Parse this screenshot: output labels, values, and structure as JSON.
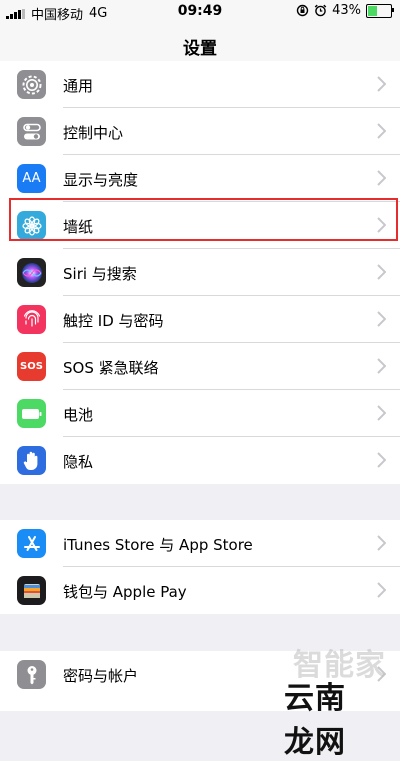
{
  "status_bar": {
    "carrier": "中国移动",
    "network": "4G",
    "time": "09:49",
    "battery": "43%",
    "battery_level": 0.43
  },
  "nav": {
    "title": "设置"
  },
  "groups": [
    {
      "items": [
        {
          "label": "通用",
          "icon": "gear-icon",
          "color": "#8e8e93"
        },
        {
          "label": "控制中心",
          "icon": "toggle-icon",
          "color": "#8e8e93"
        },
        {
          "label": "显示与亮度",
          "icon": "aa-icon",
          "color": "#1a7cf5",
          "icon_text": "AA"
        },
        {
          "label": "墙纸",
          "icon": "flower-icon",
          "color": "#34aadc"
        },
        {
          "label": "Siri 与搜索",
          "icon": "siri-icon",
          "color": "#222222"
        },
        {
          "label": "触控 ID 与密码",
          "icon": "fingerprint-icon",
          "color": "#f2345f"
        },
        {
          "label": "SOS 紧急联络",
          "icon": "sos-icon",
          "color": "#e63b2e",
          "icon_text": "SOS"
        },
        {
          "label": "电池",
          "icon": "battery-icon",
          "color": "#4cd964"
        },
        {
          "label": "隐私",
          "icon": "hand-icon",
          "color": "#2d6de0"
        }
      ]
    },
    {
      "items": [
        {
          "label": "iTunes Store 与 App Store",
          "icon": "app-store-icon",
          "color": "#1a8cf5"
        },
        {
          "label": "钱包与 Apple Pay",
          "icon": "wallet-icon",
          "color": "#1c1c1e"
        }
      ]
    },
    {
      "items": [
        {
          "label": "密码与帐户",
          "icon": "key-icon",
          "color": "#8e8e93"
        }
      ]
    }
  ],
  "watermark": {
    "top": "智能家",
    "bottom": "云南龙网"
  }
}
